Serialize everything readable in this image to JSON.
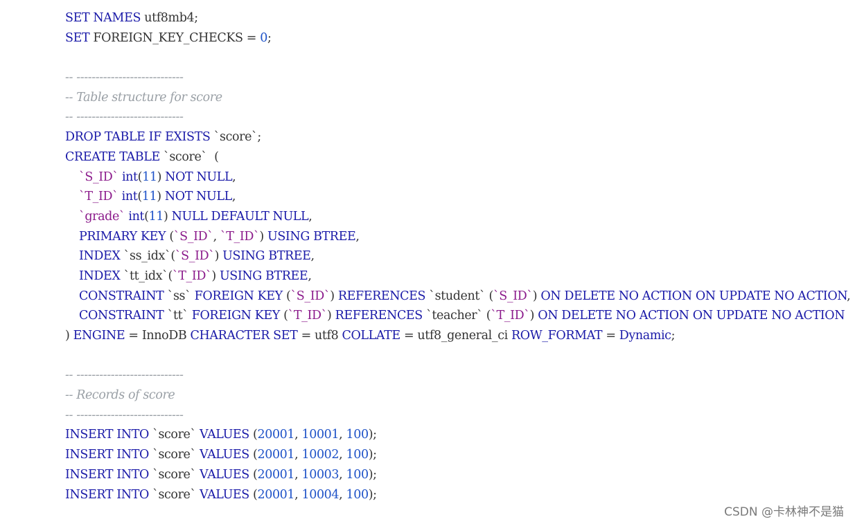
{
  "code_lines": [
    [
      {
        "t": "SET NAMES",
        "c": "kw"
      },
      {
        "t": " utf8mb4;",
        "c": "plain"
      }
    ],
    [
      {
        "t": "SET",
        "c": "kw"
      },
      {
        "t": " FOREIGN_KEY_CHECKS = ",
        "c": "plain"
      },
      {
        "t": "0",
        "c": "num"
      },
      {
        "t": ";",
        "c": "plain"
      }
    ],
    [],
    [
      {
        "t": "-- ----------------------------",
        "c": "cmt"
      }
    ],
    [
      {
        "t": "-- Table structure for score",
        "c": "cmt"
      }
    ],
    [
      {
        "t": "-- ----------------------------",
        "c": "cmt"
      }
    ],
    [
      {
        "t": "DROP TABLE IF EXISTS",
        "c": "kw"
      },
      {
        "t": " `score`;",
        "c": "plain"
      }
    ],
    [
      {
        "t": "CREATE TABLE",
        "c": "kw"
      },
      {
        "t": " `score`  (",
        "c": "plain"
      }
    ],
    [
      {
        "t": "",
        "c": "indent"
      },
      {
        "t": "`S_ID`",
        "c": "fld"
      },
      {
        "t": " int",
        "c": "kw"
      },
      {
        "t": "(",
        "c": "plain"
      },
      {
        "t": "11",
        "c": "num"
      },
      {
        "t": ") ",
        "c": "plain"
      },
      {
        "t": "NOT NULL",
        "c": "kw"
      },
      {
        "t": ",",
        "c": "plain"
      }
    ],
    [
      {
        "t": "",
        "c": "indent"
      },
      {
        "t": "`T_ID`",
        "c": "fld"
      },
      {
        "t": " int",
        "c": "kw"
      },
      {
        "t": "(",
        "c": "plain"
      },
      {
        "t": "11",
        "c": "num"
      },
      {
        "t": ") ",
        "c": "plain"
      },
      {
        "t": "NOT NULL",
        "c": "kw"
      },
      {
        "t": ",",
        "c": "plain"
      }
    ],
    [
      {
        "t": "",
        "c": "indent"
      },
      {
        "t": "`grade`",
        "c": "fld"
      },
      {
        "t": " int",
        "c": "kw"
      },
      {
        "t": "(",
        "c": "plain"
      },
      {
        "t": "11",
        "c": "num"
      },
      {
        "t": ") ",
        "c": "plain"
      },
      {
        "t": "NULL DEFAULT NULL",
        "c": "kw"
      },
      {
        "t": ",",
        "c": "plain"
      }
    ],
    [
      {
        "t": "",
        "c": "indent"
      },
      {
        "t": "PRIMARY KEY",
        "c": "kw"
      },
      {
        "t": " (",
        "c": "plain"
      },
      {
        "t": "`S_ID`",
        "c": "fld"
      },
      {
        "t": ", ",
        "c": "plain"
      },
      {
        "t": "`T_ID`",
        "c": "fld"
      },
      {
        "t": ") ",
        "c": "plain"
      },
      {
        "t": "USING BTREE",
        "c": "kw"
      },
      {
        "t": ",",
        "c": "plain"
      }
    ],
    [
      {
        "t": "",
        "c": "indent"
      },
      {
        "t": "INDEX",
        "c": "kw"
      },
      {
        "t": " `ss_idx`(",
        "c": "plain"
      },
      {
        "t": "`S_ID`",
        "c": "fld"
      },
      {
        "t": ") ",
        "c": "plain"
      },
      {
        "t": "USING BTREE",
        "c": "kw"
      },
      {
        "t": ",",
        "c": "plain"
      }
    ],
    [
      {
        "t": "",
        "c": "indent"
      },
      {
        "t": "INDEX",
        "c": "kw"
      },
      {
        "t": " `tt_idx`(",
        "c": "plain"
      },
      {
        "t": "`T_ID`",
        "c": "fld"
      },
      {
        "t": ") ",
        "c": "plain"
      },
      {
        "t": "USING BTREE",
        "c": "kw"
      },
      {
        "t": ",",
        "c": "plain"
      }
    ],
    [
      {
        "t": "",
        "c": "indent"
      },
      {
        "t": "CONSTRAINT",
        "c": "kw"
      },
      {
        "t": " `ss` ",
        "c": "plain"
      },
      {
        "t": "FOREIGN KEY",
        "c": "kw"
      },
      {
        "t": " (",
        "c": "plain"
      },
      {
        "t": "`S_ID`",
        "c": "fld"
      },
      {
        "t": ") ",
        "c": "plain"
      },
      {
        "t": "REFERENCES",
        "c": "kw"
      },
      {
        "t": " `student` (",
        "c": "plain"
      },
      {
        "t": "`S_ID`",
        "c": "fld"
      },
      {
        "t": ") ",
        "c": "plain"
      },
      {
        "t": "ON DELETE NO ACTION ON UPDATE NO ACTION",
        "c": "kw"
      },
      {
        "t": ",",
        "c": "plain"
      }
    ],
    [
      {
        "t": "",
        "c": "indent"
      },
      {
        "t": "CONSTRAINT",
        "c": "kw"
      },
      {
        "t": " `tt` ",
        "c": "plain"
      },
      {
        "t": "FOREIGN KEY",
        "c": "kw"
      },
      {
        "t": " (",
        "c": "plain"
      },
      {
        "t": "`T_ID`",
        "c": "fld"
      },
      {
        "t": ") ",
        "c": "plain"
      },
      {
        "t": "REFERENCES",
        "c": "kw"
      },
      {
        "t": " `teacher` (",
        "c": "plain"
      },
      {
        "t": "`T_ID`",
        "c": "fld"
      },
      {
        "t": ") ",
        "c": "plain"
      },
      {
        "t": "ON DELETE NO ACTION ON UPDATE NO ACTION",
        "c": "kw"
      }
    ],
    [
      {
        "t": ") ",
        "c": "plain"
      },
      {
        "t": "ENGINE",
        "c": "kw"
      },
      {
        "t": " = InnoDB ",
        "c": "plain"
      },
      {
        "t": "CHARACTER SET",
        "c": "kw"
      },
      {
        "t": " = utf8 ",
        "c": "plain"
      },
      {
        "t": "COLLATE",
        "c": "kw"
      },
      {
        "t": " = utf8_general_ci ",
        "c": "plain"
      },
      {
        "t": "ROW_FORMAT",
        "c": "kw"
      },
      {
        "t": " = ",
        "c": "plain"
      },
      {
        "t": "Dynamic",
        "c": "kw"
      },
      {
        "t": ";",
        "c": "plain"
      }
    ],
    [],
    [
      {
        "t": "-- ----------------------------",
        "c": "cmt"
      }
    ],
    [
      {
        "t": "-- Records of score",
        "c": "cmt"
      }
    ],
    [
      {
        "t": "-- ----------------------------",
        "c": "cmt"
      }
    ],
    [
      {
        "t": "INSERT INTO",
        "c": "kw"
      },
      {
        "t": " `score` ",
        "c": "plain"
      },
      {
        "t": "VALUES",
        "c": "kw"
      },
      {
        "t": " (",
        "c": "plain"
      },
      {
        "t": "20001",
        "c": "num"
      },
      {
        "t": ", ",
        "c": "plain"
      },
      {
        "t": "10001",
        "c": "num"
      },
      {
        "t": ", ",
        "c": "plain"
      },
      {
        "t": "100",
        "c": "num"
      },
      {
        "t": ");",
        "c": "plain"
      }
    ],
    [
      {
        "t": "INSERT INTO",
        "c": "kw"
      },
      {
        "t": " `score` ",
        "c": "plain"
      },
      {
        "t": "VALUES",
        "c": "kw"
      },
      {
        "t": " (",
        "c": "plain"
      },
      {
        "t": "20001",
        "c": "num"
      },
      {
        "t": ", ",
        "c": "plain"
      },
      {
        "t": "10002",
        "c": "num"
      },
      {
        "t": ", ",
        "c": "plain"
      },
      {
        "t": "100",
        "c": "num"
      },
      {
        "t": ");",
        "c": "plain"
      }
    ],
    [
      {
        "t": "INSERT INTO",
        "c": "kw"
      },
      {
        "t": " `score` ",
        "c": "plain"
      },
      {
        "t": "VALUES",
        "c": "kw"
      },
      {
        "t": " (",
        "c": "plain"
      },
      {
        "t": "20001",
        "c": "num"
      },
      {
        "t": ", ",
        "c": "plain"
      },
      {
        "t": "10003",
        "c": "num"
      },
      {
        "t": ", ",
        "c": "plain"
      },
      {
        "t": "100",
        "c": "num"
      },
      {
        "t": ");",
        "c": "plain"
      }
    ],
    [
      {
        "t": "INSERT INTO",
        "c": "kw"
      },
      {
        "t": " `score` ",
        "c": "plain"
      },
      {
        "t": "VALUES",
        "c": "kw"
      },
      {
        "t": " (",
        "c": "plain"
      },
      {
        "t": "20001",
        "c": "num"
      },
      {
        "t": ", ",
        "c": "plain"
      },
      {
        "t": "10004",
        "c": "num"
      },
      {
        "t": ", ",
        "c": "plain"
      },
      {
        "t": "100",
        "c": "num"
      },
      {
        "t": ");",
        "c": "plain"
      }
    ]
  ],
  "watermark": "CSDN @卡林神不是猫",
  "colors": {
    "keyword": "#1a1aa8",
    "identifier": "#8b1a8b",
    "number": "#1e52c8",
    "comment": "#9aa0a6",
    "text": "#333333"
  }
}
